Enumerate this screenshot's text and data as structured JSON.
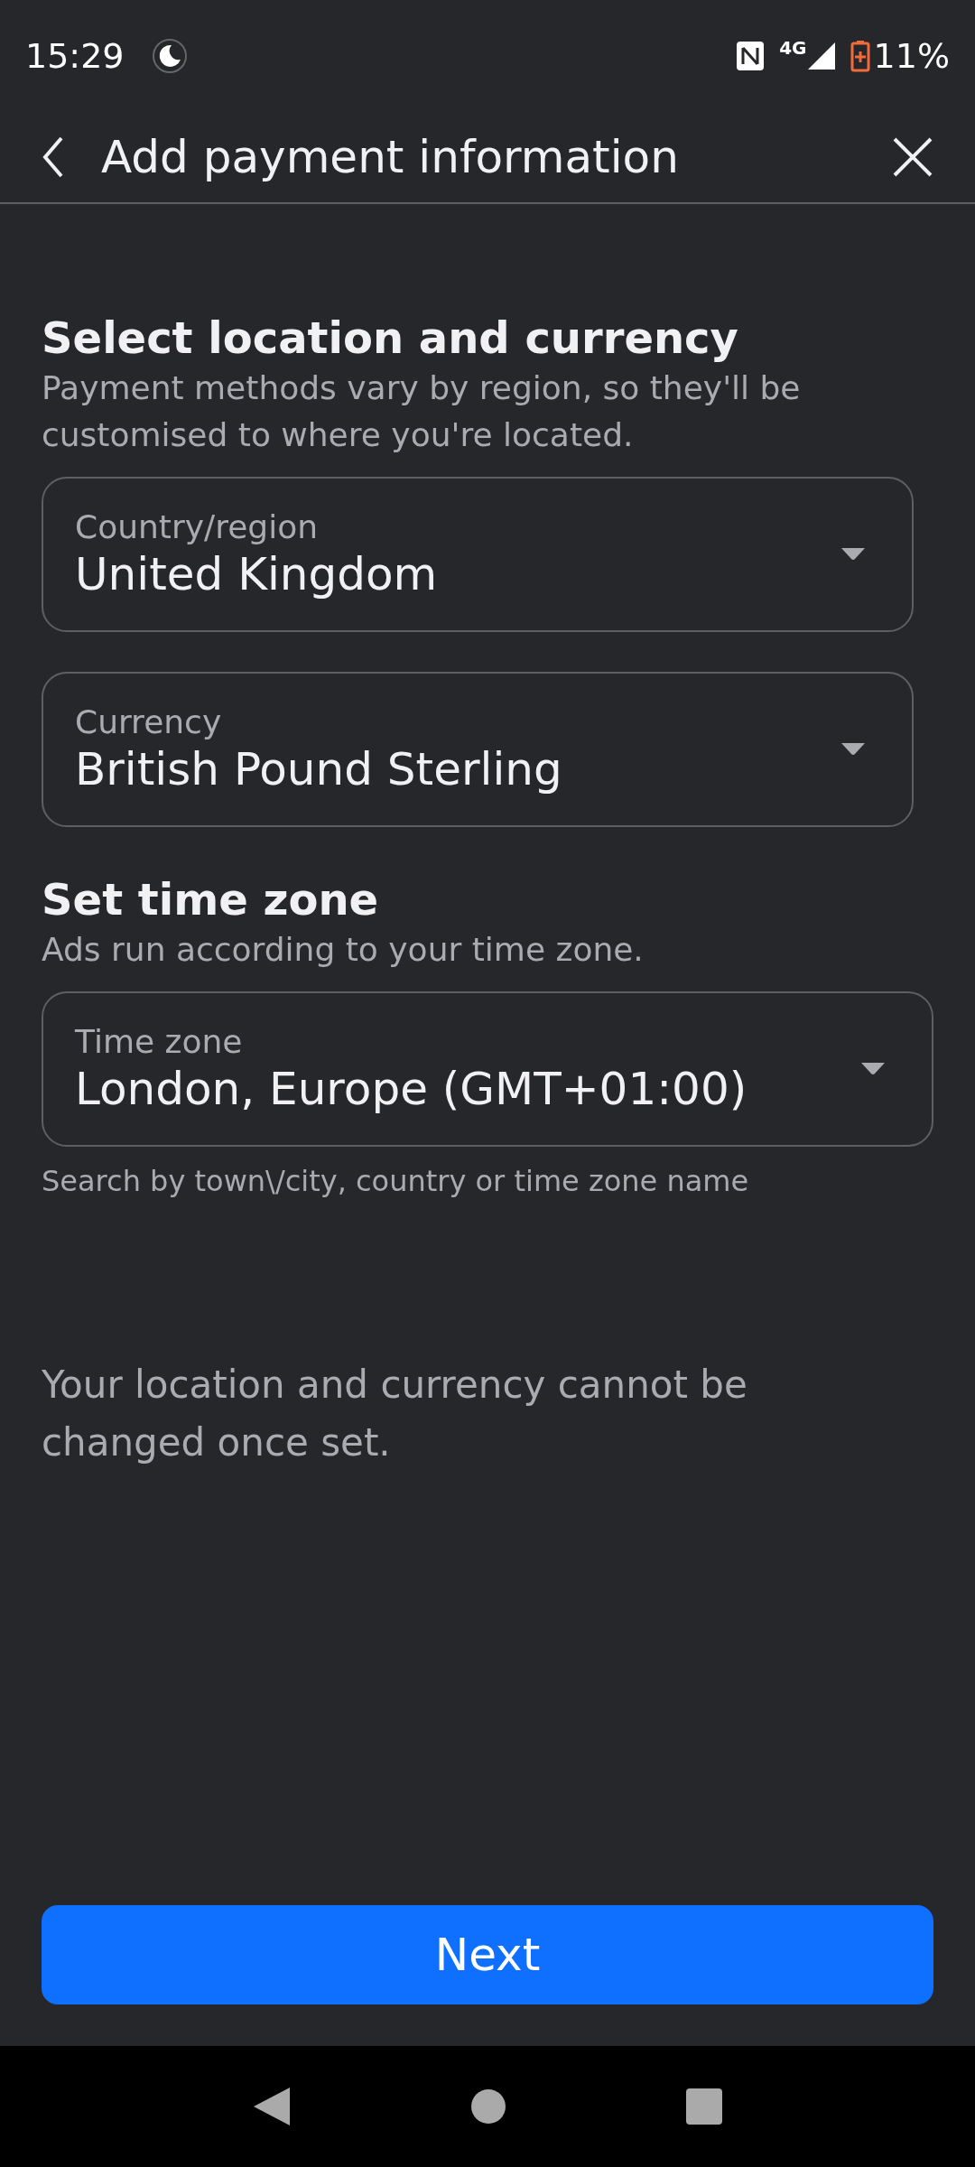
{
  "status_bar": {
    "time": "15:29",
    "battery": "11%",
    "network": "4G"
  },
  "header": {
    "title": "Add payment information"
  },
  "sections": [
    {
      "title": "Select location and currency",
      "description": "Payment methods vary by region, so they'll be customised to where you're located.",
      "fields": [
        {
          "label": "Country/region",
          "value": "United Kingdom"
        },
        {
          "label": "Currency",
          "value": "British Pound Sterling"
        }
      ]
    },
    {
      "title": "Set time zone",
      "description": "Ads run according to your time zone.",
      "fields": [
        {
          "label": "Time zone",
          "value": "London, Europe (GMT+01:00)",
          "helper": "Search by town\\/city, country or time zone name"
        }
      ]
    }
  ],
  "notice": "Your location and currency cannot be changed once set.",
  "next_button": "Next"
}
